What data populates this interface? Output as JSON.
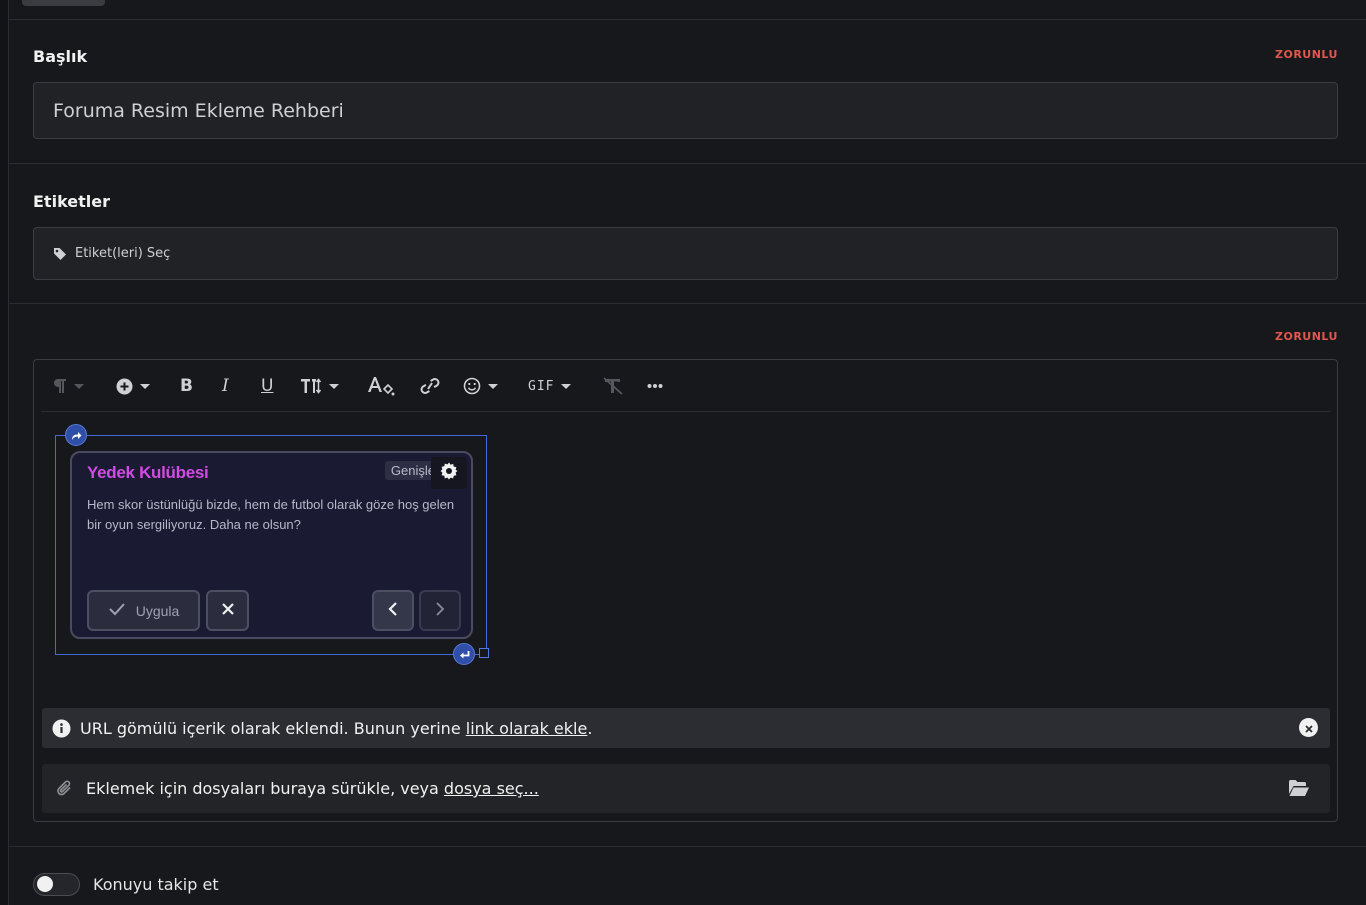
{
  "title_field": {
    "label": "Başlık",
    "required": "ZORUNLU",
    "value": "Foruma Resim Ekleme Rehberi"
  },
  "tags_field": {
    "label": "Etiketler",
    "placeholder": "Etiket(leri) Seç"
  },
  "editor": {
    "required": "ZORUNLU",
    "toolbar": {
      "paragraph_icon": "pilcrow-icon",
      "insert_icon": "plus-circle-icon",
      "bold": "B",
      "italic": "I",
      "underline": "U",
      "font_size_icon": "text-size-icon",
      "text_color_icon": "text-color-icon",
      "link_icon": "link-icon",
      "emoji_icon": "smile-icon",
      "gif": "GIF",
      "clear_format_icon": "clear-format-icon",
      "more_icon": "more-icon"
    },
    "embed": {
      "card_title": "Yedek Kulübesi",
      "expand_label": "Genişle",
      "text": "Hem skor üstünlüğü bizde, hem de futbol olarak göze hoş gelen bir oyun sergiliyoruz. Daha ne olsun?",
      "apply_label": "Uygula"
    },
    "notice": {
      "text": "URL gömülü içerik olarak eklendi. Bunun yerine",
      "link": "link olarak ekle",
      "suffix": "."
    },
    "attach": {
      "text": "Eklemek için dosyaları buraya sürükle, veya",
      "link": "dosya seç..."
    }
  },
  "follow": {
    "label": "Konuyu takip et",
    "enabled": false
  },
  "colors": {
    "required": "#e2574c",
    "accent": "#3f6ad8",
    "card_title": "#d24be3"
  }
}
